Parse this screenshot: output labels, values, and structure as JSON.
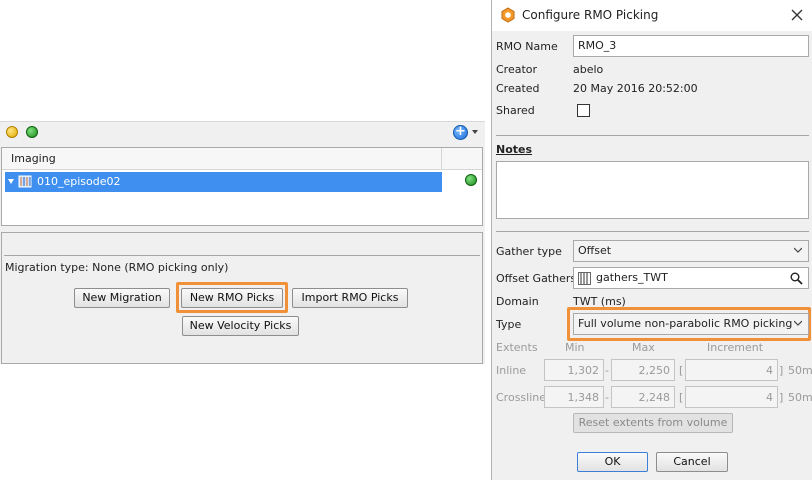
{
  "left_panel": {
    "tree_header": "Imaging",
    "tree_item": "010_episode02",
    "migration_type": "Migration type: None (RMO picking only)",
    "buttons": {
      "new_migration": "New Migration",
      "new_rmo_picks": "New RMO Picks",
      "import_rmo_picks": "Import RMO Picks",
      "new_velocity_picks": "New Velocity Picks"
    },
    "colors": {
      "selection": "#3e8ff0",
      "highlight": "#f0913a",
      "status_green": "#1a8a1a"
    }
  },
  "dialog": {
    "title": "Configure RMO Picking",
    "rmo_name_label": "RMO Name",
    "rmo_name_value": "RMO_3",
    "creator_label": "Creator",
    "creator_value": "abelo",
    "created_label": "Created",
    "created_value": "20 May 2016 20:52:00",
    "shared_label": "Shared",
    "notes_label": "Notes",
    "gather_type_label": "Gather type",
    "gather_type_value": "Offset",
    "offset_gathers_label": "Offset Gathers",
    "offset_gathers_value": "gathers_TWT",
    "domain_label": "Domain",
    "domain_value": "TWT (ms)",
    "type_label": "Type",
    "type_value": "Full volume non-parabolic RMO picking",
    "extents_label": "Extents",
    "min_label": "Min",
    "max_label": "Max",
    "increment_label": "Increment",
    "inline_label": "Inline",
    "inline_min": "1,302",
    "inline_max": "2,250",
    "inline_increment": "4",
    "crossline_label": "Crossline",
    "crossline_min": "1,348",
    "crossline_max": "2,248",
    "crossline_increment": "4",
    "dash": "-",
    "bracket_open": "[",
    "bracket_close": "]",
    "spacing_unit": "50m",
    "reset_button": "Reset extents from volume",
    "ok_button": "OK",
    "cancel_button": "Cancel"
  }
}
